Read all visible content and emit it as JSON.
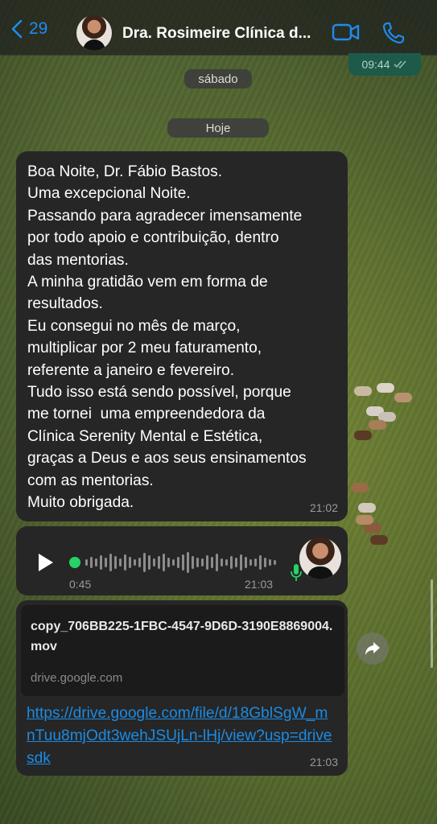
{
  "header": {
    "back_count": "29",
    "contact_name": "Dra. Rosimeire Clínica d..."
  },
  "previous_message": {
    "time": "09:44"
  },
  "date_chips": {
    "saturday": "sábado",
    "today": "Hoje"
  },
  "text_message": {
    "lines": [
      "Boa Noite, Dr. Fábio Bastos.",
      "Uma excepcional Noite.",
      "Passando para agradecer imensamente",
      "por todo apoio e contribuição, dentro",
      "das mentorias.",
      "A minha gratidão vem em forma de",
      "resultados.",
      "Eu consegui no mês de março,",
      "multiplicar por 2 meu faturamento,",
      "referente a janeiro e fevereiro.",
      "Tudo isso está sendo possível, porque",
      "me tornei  uma empreendedora da",
      "Clínica Serenity Mental e Estética,",
      "graças a Deus e aos seus ensinamentos",
      "com as mentorias.",
      "Muito obrigada."
    ],
    "time": "21:02"
  },
  "voice_message": {
    "duration": "0:45",
    "time": "21:03",
    "progress": 0.0
  },
  "link_message": {
    "file_title": "copy_706BB225-1FBC-4547-9D6D-3190E8869004.mov",
    "domain": "drive.google.com",
    "url": "https://drive.google.com/file/d/18GblSgW_mnTuu8mjOdt3wehJSUjLn-lHj/view?usp=drivesdk",
    "time": "21:03"
  },
  "colors": {
    "accent_blue": "#1d8cf0",
    "bubble": "#262626",
    "voice_green": "#25d366"
  },
  "icons": [
    "chevron-left-icon",
    "video-call-icon",
    "phone-icon",
    "play-icon",
    "microphone-icon",
    "share-icon",
    "read-receipt-icon"
  ]
}
